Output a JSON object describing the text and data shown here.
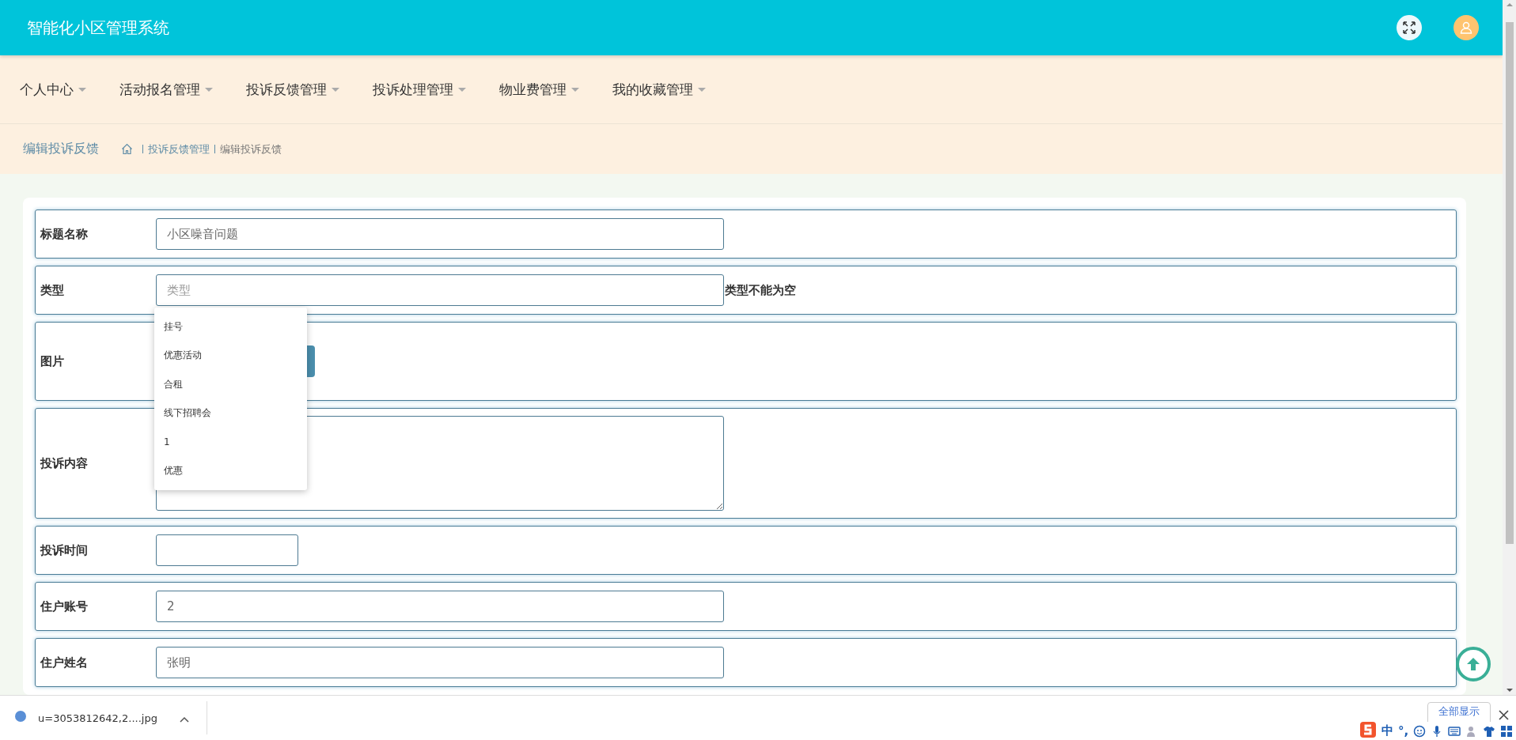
{
  "header": {
    "title": "智能化小区管理系统"
  },
  "nav": [
    {
      "label": "个人中心"
    },
    {
      "label": "活动报名管理"
    },
    {
      "label": "投诉反馈管理"
    },
    {
      "label": "投诉处理管理"
    },
    {
      "label": "物业费管理"
    },
    {
      "label": "我的收藏管理"
    }
  ],
  "breadcrumb": {
    "page_title": "编辑投诉反馈",
    "items": [
      "投诉反馈管理",
      "编辑投诉反馈"
    ]
  },
  "form": {
    "rows": [
      {
        "label": "标题名称",
        "kind": "text",
        "value": "小区噪音问题"
      },
      {
        "label": "类型",
        "kind": "text",
        "placeholder": "类型",
        "error": "类型不能为空"
      },
      {
        "label": "图片",
        "kind": "upload"
      },
      {
        "label": "投诉内容",
        "kind": "textarea"
      },
      {
        "label": "投诉时间",
        "kind": "date"
      },
      {
        "label": "住户账号",
        "kind": "text",
        "value": "2"
      },
      {
        "label": "住户姓名",
        "kind": "text",
        "value": "张明"
      }
    ]
  },
  "autocomplete": {
    "options": [
      "挂号",
      "优惠活动",
      "合租",
      "线下招聘会",
      "1",
      "优惠"
    ]
  },
  "download_bar": {
    "file": "u=3053812642,2....jpg",
    "show_all": "全部显示"
  },
  "ime_toolbar": {
    "mode": "中",
    "punctuation": "°,"
  }
}
